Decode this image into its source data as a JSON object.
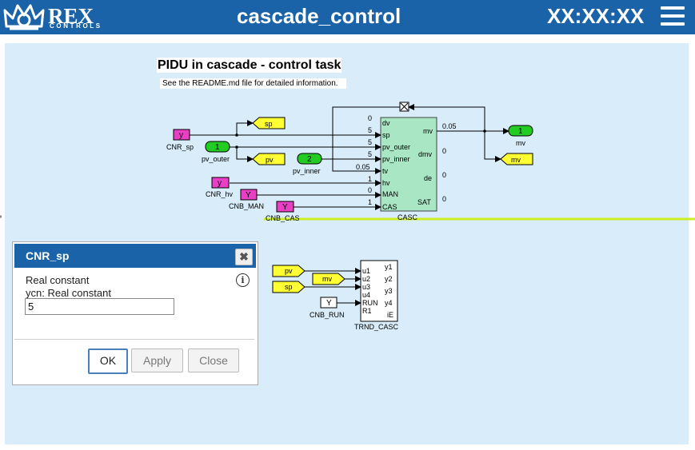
{
  "header": {
    "logo_text": "REX",
    "logo_sub": "CONTROLS",
    "title": "cascade_control",
    "clock": "XX:XX:XX",
    "menu_icon": "hamburger-icon"
  },
  "diagram": {
    "title": "PIDU in cascade - control task",
    "subtitle": "See the README.md file for detailed information.",
    "casc_block": {
      "name": "CASC",
      "inputs": [
        "dv",
        "sp",
        "pv_outer",
        "pv_inner",
        "tv",
        "hv",
        "MAN",
        "CAS"
      ],
      "input_values": [
        "0",
        "5",
        "5",
        "5",
        "0.05",
        "1",
        "0",
        "1"
      ],
      "outputs": [
        "mv",
        "dmv",
        "de",
        "SAT"
      ],
      "output_values": [
        "0.05",
        "0",
        "0",
        "0"
      ]
    },
    "trnd_block": {
      "name": "TRND_CASC",
      "inputs": [
        "u1",
        "u2",
        "u3",
        "u4",
        "RUN",
        "R1"
      ],
      "outputs": [
        "y1",
        "y2",
        "y3",
        "y4",
        "iE"
      ]
    },
    "constants": {
      "cnr_sp": {
        "value": "y",
        "label": "CNR_sp"
      },
      "cnr_hv": {
        "value": "y",
        "label": "CNR_hv"
      },
      "cnb_man": {
        "value": "Y",
        "label": "CNB_MAN"
      },
      "cnb_cas": {
        "value": "Y",
        "label": "CNB_CAS"
      },
      "cnb_run": {
        "value": "Y",
        "label": "CNB_RUN"
      }
    },
    "inports": {
      "pv_outer": {
        "value": "1",
        "label": "pv_outer"
      },
      "pv_inner": {
        "value": "2",
        "label": "pv_inner"
      }
    },
    "outport_mv": {
      "value": "1",
      "label": "mv"
    },
    "goto_tags": {
      "sp": "sp",
      "pv": "pv",
      "mv": "mv"
    },
    "from_tags": {
      "pv": "pv",
      "mv": "mv",
      "sp": "sp"
    }
  },
  "dialog": {
    "title": "CNR_sp",
    "close_icon": "close-icon",
    "info_icon": "info-icon",
    "line1": "Real constant",
    "line2": "ycn: Real constant",
    "value": "5",
    "ok_label": "OK",
    "apply_label": "Apply",
    "close_label": "Close"
  },
  "colors": {
    "header_bg": "#1a63a8",
    "canvas_bg": "#d8ecf9",
    "block_fill": "#a8e6c4",
    "constant_fill": "#e83fc4",
    "inport_fill": "#22cc22",
    "tag_fill": "#ffff33",
    "highlight_line": "#ccee22"
  }
}
